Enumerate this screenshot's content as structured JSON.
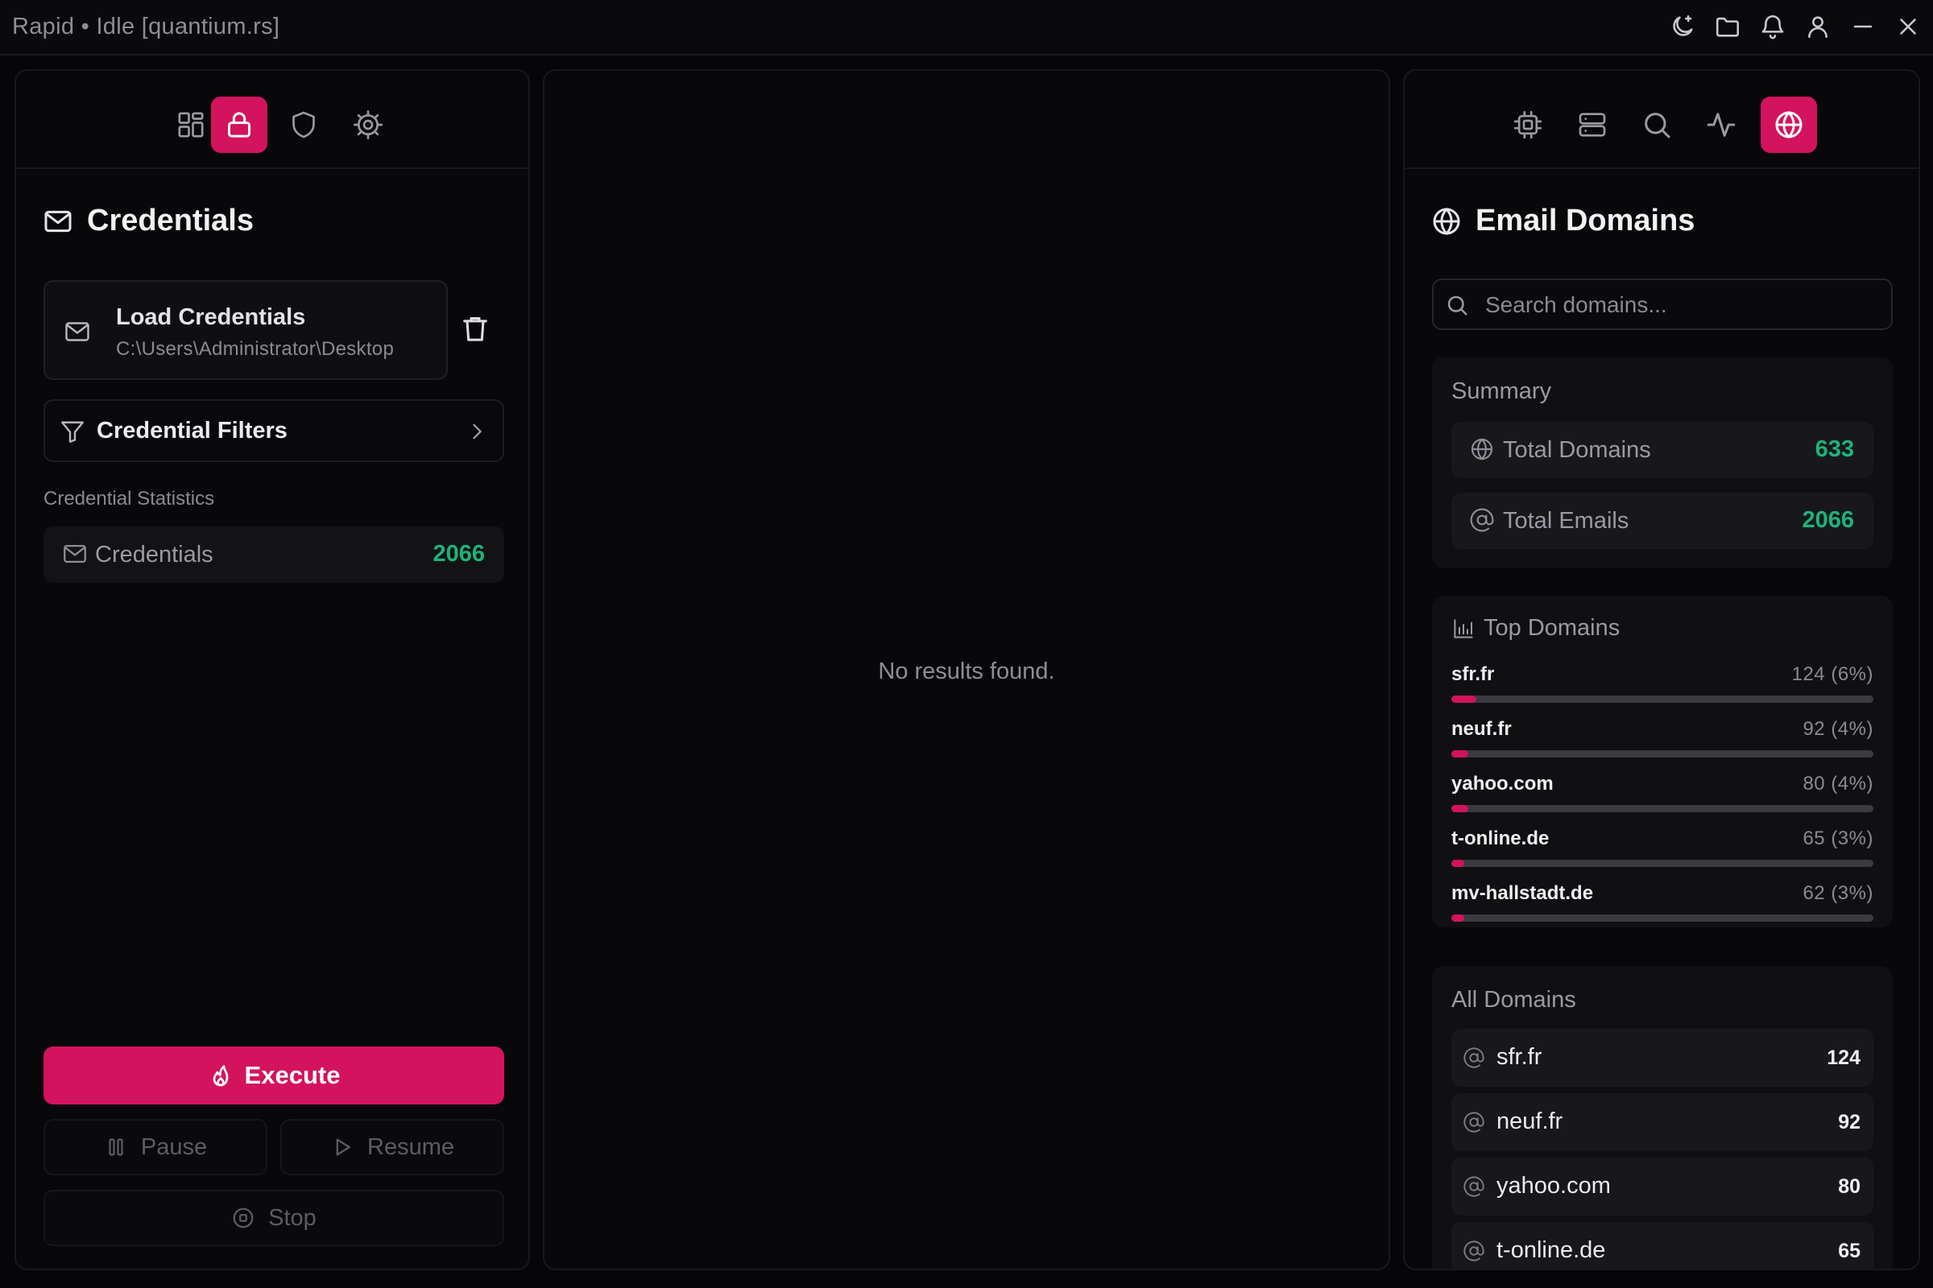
{
  "window": {
    "title": "Rapid • Idle [quantium.rs]",
    "icons": [
      "theme-moon-icon",
      "folder-icon",
      "bell-icon",
      "user-icon",
      "minimize-icon",
      "close-icon"
    ]
  },
  "left_panel": {
    "tabs": [
      {
        "name": "dashboard-icon",
        "active": false
      },
      {
        "name": "lock-icon",
        "active": true
      },
      {
        "name": "shield-icon",
        "active": false
      },
      {
        "name": "settings-icon",
        "active": false
      }
    ],
    "section_title": "Credentials",
    "load": {
      "title": "Load Credentials",
      "path": "C:\\Users\\Administrator\\Desktop"
    },
    "filters_label": "Credential Filters",
    "stats_label": "Credential Statistics",
    "stats": [
      {
        "label": "Credentials",
        "value": "2066"
      }
    ],
    "actions": {
      "execute": "Execute",
      "pause": "Pause",
      "resume": "Resume",
      "stop": "Stop"
    }
  },
  "center_panel": {
    "empty_text": "No results found."
  },
  "right_panel": {
    "tabs": [
      {
        "name": "cpu-icon",
        "active": false
      },
      {
        "name": "server-icon",
        "active": false
      },
      {
        "name": "search-icon",
        "active": false
      },
      {
        "name": "activity-icon",
        "active": false
      },
      {
        "name": "globe-icon",
        "active": true
      }
    ],
    "section_title": "Email Domains",
    "search_placeholder": "Search domains...",
    "summary": {
      "title": "Summary",
      "rows": [
        {
          "label": "Total Domains",
          "value": "633"
        },
        {
          "label": "Total Emails",
          "value": "2066"
        }
      ]
    },
    "top_domains": {
      "title": "Top Domains",
      "items": [
        {
          "domain": "sfr.fr",
          "count": "124 (6%)",
          "fraction": 0.06
        },
        {
          "domain": "neuf.fr",
          "count": "92 (4%)",
          "fraction": 0.04
        },
        {
          "domain": "yahoo.com",
          "count": "80 (4%)",
          "fraction": 0.04
        },
        {
          "domain": "t-online.de",
          "count": "65 (3%)",
          "fraction": 0.03
        },
        {
          "domain": "mv-hallstadt.de",
          "count": "62 (3%)",
          "fraction": 0.03
        }
      ]
    },
    "all_domains": {
      "title": "All Domains",
      "items": [
        {
          "domain": "sfr.fr",
          "count": "124"
        },
        {
          "domain": "neuf.fr",
          "count": "92"
        },
        {
          "domain": "yahoo.com",
          "count": "80"
        },
        {
          "domain": "t-online.de",
          "count": "65"
        }
      ]
    }
  },
  "colors": {
    "accent": "#d3135d",
    "success": "#1fb27a",
    "background": "#060608"
  }
}
